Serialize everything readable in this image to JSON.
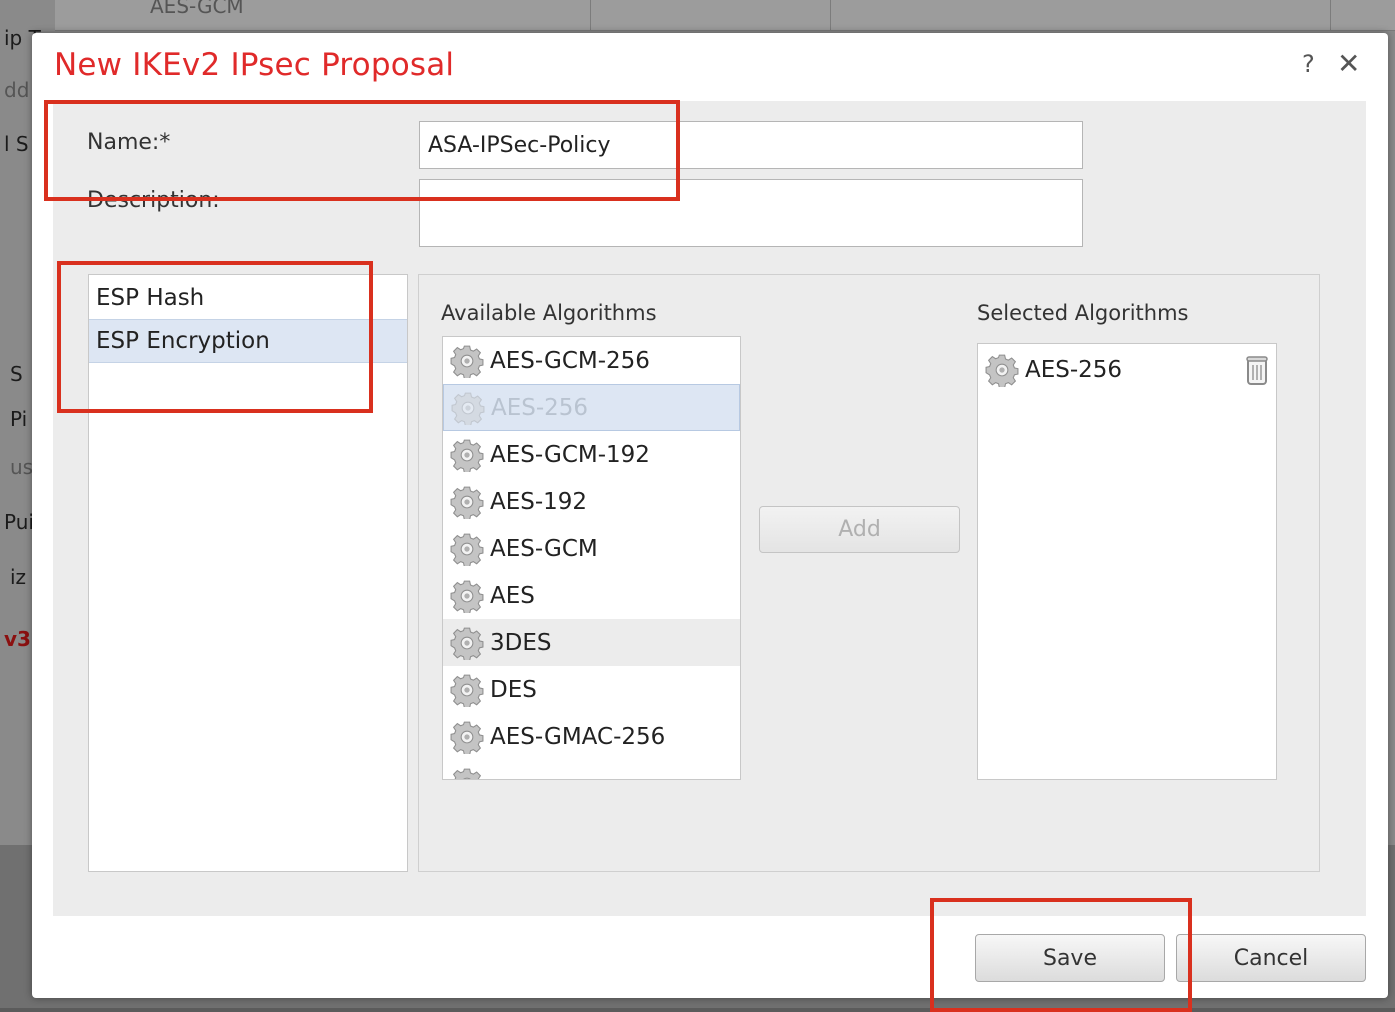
{
  "background": {
    "top_cell_text": "AES-GCM",
    "side_labels": [
      "ip T",
      "dd",
      "l S",
      "S",
      "Pi",
      "us",
      "Pui",
      "iz",
      "v3"
    ]
  },
  "dialog": {
    "title": "New IKEv2 IPsec Proposal",
    "help_glyph": "?",
    "close_glyph": "✕",
    "name_label": "Name:*",
    "name_value": "ASA-IPSec-Policy",
    "description_label": "Description:",
    "description_value": "",
    "categories": [
      {
        "label": "ESP Hash",
        "selected": false
      },
      {
        "label": "ESP Encryption",
        "selected": true
      }
    ],
    "available_label": "Available Algorithms",
    "selected_label": "Selected Algorithms",
    "available_algorithms": [
      "AES-GCM-256",
      "AES-256",
      "AES-GCM-192",
      "AES-192",
      "AES-GCM",
      "AES",
      "3DES",
      "DES",
      "AES-GMAC-256"
    ],
    "selected_algorithms": [
      "AES-256"
    ],
    "add_label": "Add",
    "save_label": "Save",
    "cancel_label": "Cancel"
  },
  "colors": {
    "title": "#e02a2a",
    "highlight": "#d9301e",
    "selection": "#dde6f3"
  },
  "icons": {
    "algorithm": "gear-icon",
    "remove": "trash-icon"
  }
}
